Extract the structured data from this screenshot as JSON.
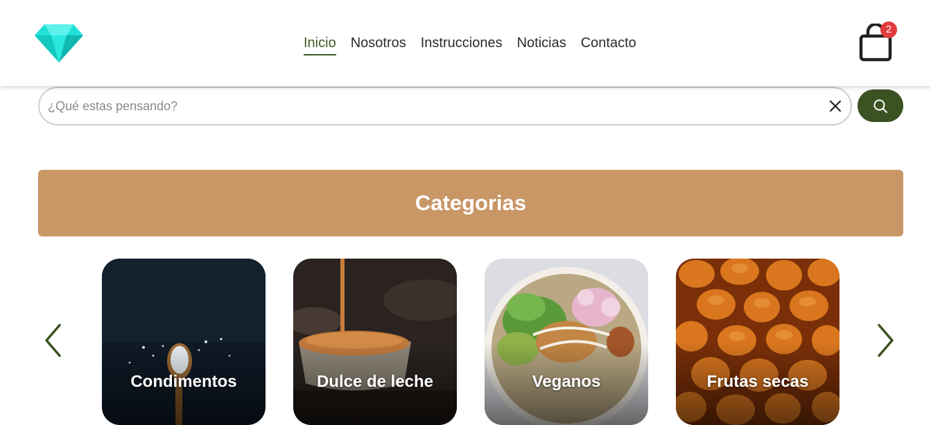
{
  "header": {
    "logo_icon": "diamond-icon",
    "nav": [
      {
        "label": "Inicio",
        "active": true
      },
      {
        "label": "Nosotros",
        "active": false
      },
      {
        "label": "Instrucciones",
        "active": false
      },
      {
        "label": "Noticias",
        "active": false
      },
      {
        "label": "Contacto",
        "active": false
      }
    ],
    "cart_icon": "shopping-bag-icon",
    "cart_count": "2"
  },
  "search": {
    "placeholder": "¿Qué estas pensando?",
    "value": "",
    "clear_icon": "close-icon",
    "button_icon": "search-icon"
  },
  "categories": {
    "title": "Categorias",
    "prev_icon": "chevron-left-icon",
    "next_icon": "chevron-right-icon",
    "items": [
      {
        "label": "Condimentos"
      },
      {
        "label": "Dulce de leche"
      },
      {
        "label": "Veganos"
      },
      {
        "label": "Frutas secas"
      }
    ]
  },
  "colors": {
    "accent": "#3b5323",
    "banner": "#c99666",
    "badge": "#e23b3b",
    "logo": "#1ee3d9"
  }
}
